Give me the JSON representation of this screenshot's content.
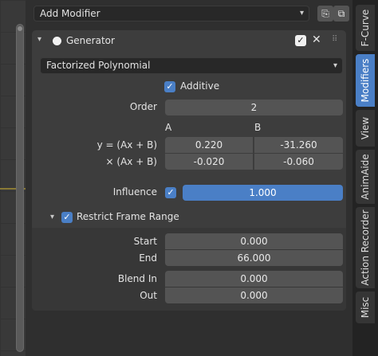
{
  "topbar": {
    "add_modifier_label": "Add Modifier"
  },
  "modifier": {
    "name": "Generator",
    "mode_value": "Factorized Polynomial",
    "additive_label": "Additive",
    "order_label": "Order",
    "order_value": "2",
    "col_a": "A",
    "col_b": "B",
    "row1_label": "y = (Ax + B)",
    "row1_a": "0.220",
    "row1_b": "-31.260",
    "row2_label": "× (Ax + B)",
    "row2_a": "-0.020",
    "row2_b": "-0.060",
    "influence_label": "Influence",
    "influence_value": "1.000",
    "restrict": {
      "label": "Restrict Frame Range",
      "start_label": "Start",
      "start_value": "0.000",
      "end_label": "End",
      "end_value": "66.000",
      "blend_in_label": "Blend In",
      "blend_in_value": "0.000",
      "out_label": "Out",
      "out_value": "0.000"
    }
  },
  "tabs": [
    "F-Curve",
    "Modifiers",
    "View",
    "AnimAide",
    "Action Recorder",
    "Misc"
  ],
  "colors": {
    "accent": "#4a7fc6",
    "panel": "#3d3d3d",
    "field": "#545454"
  },
  "icons": {
    "dropdown": "chevron-down-icon",
    "copy": "copy-icon",
    "paste": "paste-icon",
    "collapse": "chevron-down-icon",
    "enabled": "circle-icon",
    "delete": "close-icon",
    "drag": "drag-handle-icon"
  }
}
